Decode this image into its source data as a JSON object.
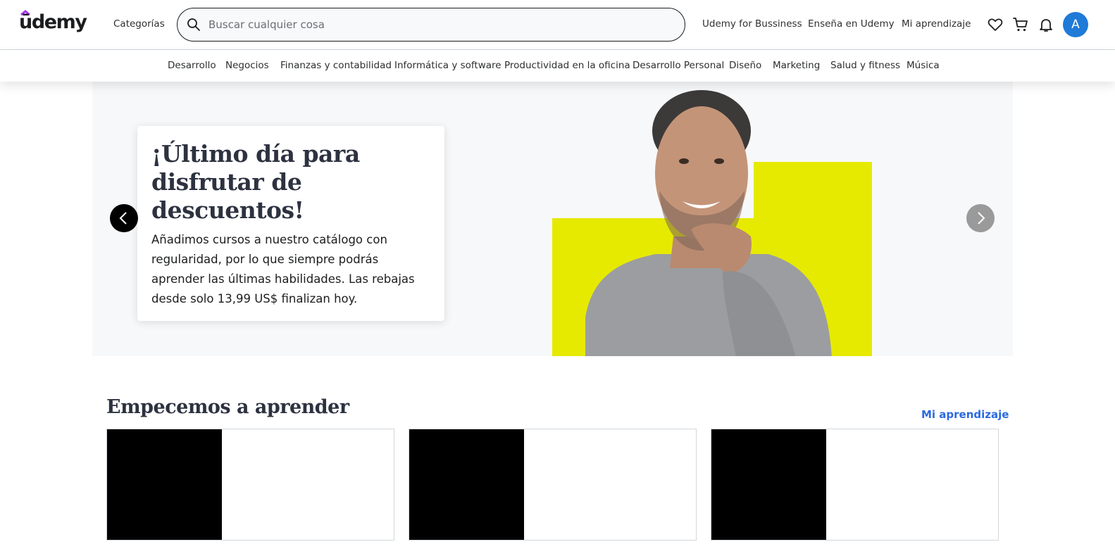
{
  "header": {
    "logo_text": "ūdemy",
    "categories_label": "Categorías",
    "search_placeholder": "Buscar cualquier cosa",
    "business_link": "Udemy for Bussiness",
    "teach_link": "Enseña en Udemy",
    "learning_link": "Mi aprendizaje",
    "avatar_initial": "A",
    "icons": [
      "search-icon",
      "heart-icon",
      "cart-icon",
      "bell-icon"
    ]
  },
  "category_nav": [
    "Desarrollo",
    "Negocios",
    "Finanzas y contabilidad",
    "Informática y software",
    "Productividad en la oficina",
    "Desarrollo Personal",
    "Diseño",
    "Marketing",
    "Salud y fitness",
    "Música"
  ],
  "hero": {
    "title": "¡Último día para disfrutar de descuentos!",
    "text": "Añadimos cursos a nuestro catálogo con regularidad, por lo que siempre podrás aprender las últimas habilidades. Las rebajas desde solo 13,99 US$ finalizan hoy.",
    "accent_color": "#e6ea00"
  },
  "section": {
    "title": "Empecemos a aprender",
    "link": "Mi aprendizaje"
  },
  "colors": {
    "brand_purple": "#a435f0",
    "link_blue": "#2b6ae0",
    "avatar_blue": "#1f7ad8"
  }
}
